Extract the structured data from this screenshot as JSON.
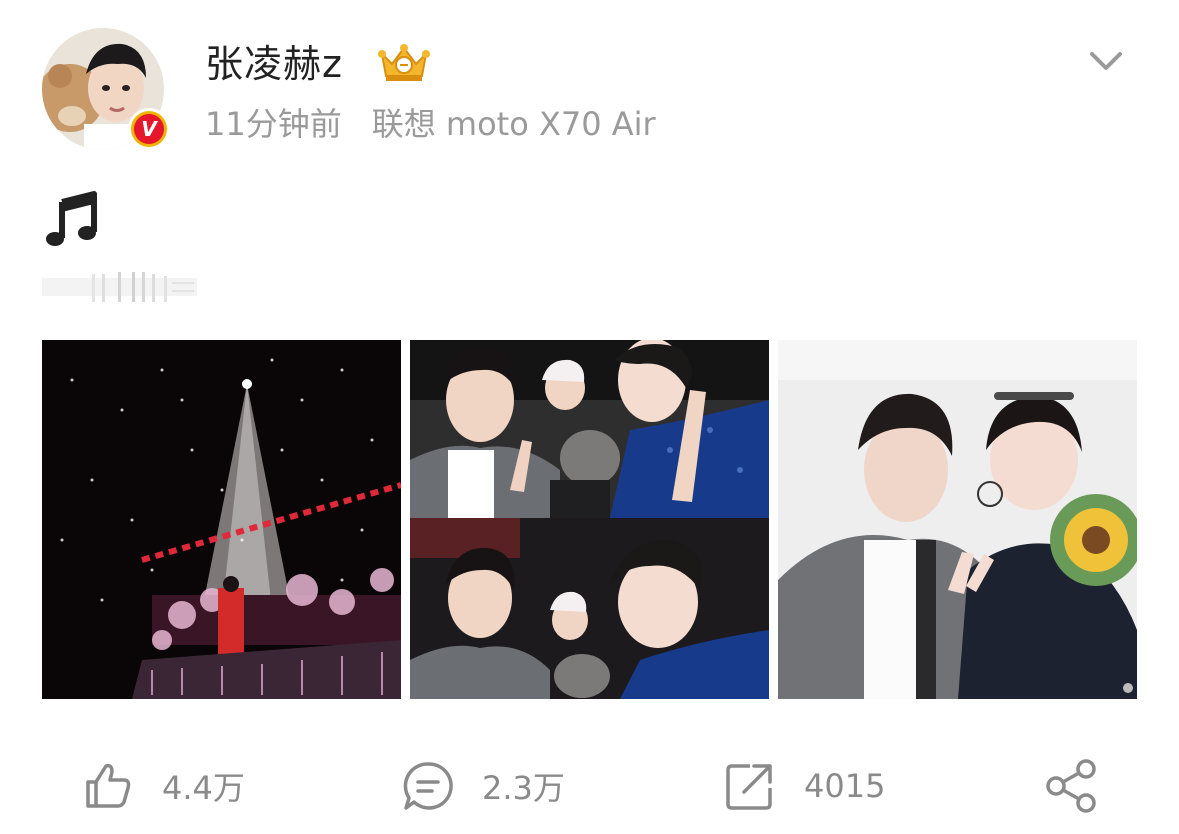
{
  "post": {
    "author": "张凌赫z",
    "time": "11分钟前",
    "source": "联想 moto X70 Air",
    "verified_badge": "V"
  },
  "actions": {
    "like_count": "4.4万",
    "comment_count": "2.3万",
    "repost_count": "4015"
  },
  "images": [
    {
      "name": "concert-stage-photo"
    },
    {
      "name": "group-selfie-collage"
    },
    {
      "name": "selfie-with-fan-photo"
    }
  ],
  "icons": {
    "crown": "crown-icon",
    "chevron": "chevron-down-icon",
    "note": "music-note-icon",
    "like": "thumbs-up-icon",
    "comment": "comment-icon",
    "repost": "repost-icon",
    "share": "share-icon"
  },
  "colors": {
    "verified_red": "#e6162d",
    "verified_ring": "#f0b400",
    "meta_gray": "#9a9a9a",
    "action_gray": "#8a8a8a"
  }
}
